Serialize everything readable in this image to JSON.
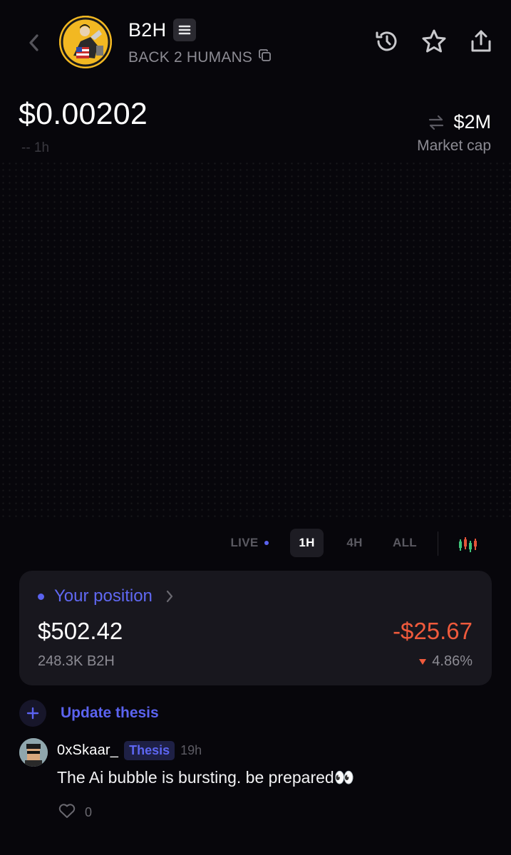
{
  "header": {
    "ticker": "B2H",
    "name": "BACK 2 HUMANS"
  },
  "price": {
    "value": "$0.00202",
    "change": "-- 1h"
  },
  "market_cap": {
    "value": "$2M",
    "label": "Market cap"
  },
  "range": {
    "live_label": "LIVE",
    "options": [
      "1H",
      "4H",
      "ALL"
    ],
    "selected": "1H"
  },
  "position": {
    "title": "Your position",
    "value": "$502.42",
    "amount": "248.3K B2H",
    "pnl": "-$25.67",
    "pnl_pct": "4.86%"
  },
  "thesis": {
    "update_label": "Update thesis",
    "comment": {
      "author": "0xSkaar_",
      "badge": "Thesis",
      "time": "19h",
      "text": "The Ai bubble is bursting. be prepared👀",
      "likes": "0"
    }
  },
  "colors": {
    "background": "#07060b",
    "accent": "#5b63f0",
    "negative": "#ef5a3c",
    "card": "#18171e",
    "muted": "#8c8b93"
  },
  "icons": {
    "back": "chevron-left-icon",
    "badge": "list-icon",
    "copy": "copy-icon",
    "history": "history-icon",
    "favorite": "star-icon",
    "share": "share-icon",
    "swap": "swap-arrows-icon",
    "candles": "candlestick-icon",
    "chevron": "chevron-right-icon",
    "down": "triangle-down-icon",
    "add": "plus-icon",
    "like": "heart-icon"
  }
}
